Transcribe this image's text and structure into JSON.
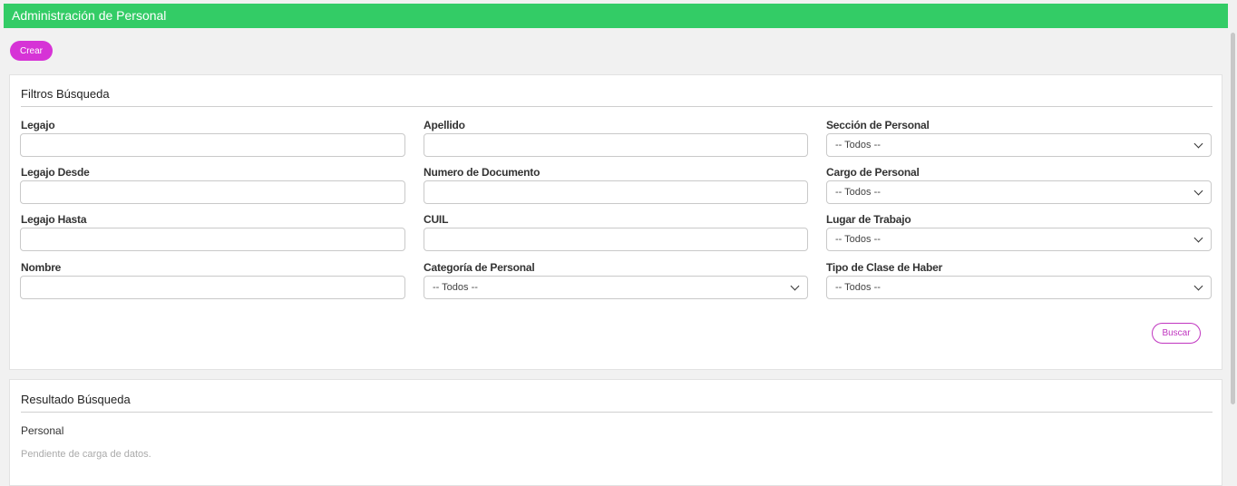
{
  "header": {
    "title": "Administración de Personal"
  },
  "actions": {
    "create_label": "Crear",
    "search_label": "Buscar"
  },
  "filters": {
    "title": "Filtros Búsqueda",
    "legajo": {
      "label": "Legajo",
      "value": ""
    },
    "legajo_desde": {
      "label": "Legajo Desde",
      "value": ""
    },
    "legajo_hasta": {
      "label": "Legajo Hasta",
      "value": ""
    },
    "nombre": {
      "label": "Nombre",
      "value": ""
    },
    "apellido": {
      "label": "Apellido",
      "value": ""
    },
    "numero_documento": {
      "label": "Numero de Documento",
      "value": ""
    },
    "cuil": {
      "label": "CUIL",
      "value": ""
    },
    "categoria_personal": {
      "label": "Categoría de Personal",
      "selected": "-- Todos --"
    },
    "seccion_personal": {
      "label": "Sección de Personal",
      "selected": "-- Todos --"
    },
    "cargo_personal": {
      "label": "Cargo de Personal",
      "selected": "-- Todos --"
    },
    "lugar_trabajo": {
      "label": "Lugar de Trabajo",
      "selected": "-- Todos --"
    },
    "tipo_clase_haber": {
      "label": "Tipo de Clase de Haber",
      "selected": "-- Todos --"
    }
  },
  "results": {
    "title": "Resultado Búsqueda",
    "subtitle": "Personal",
    "empty_message": "Pendiente de carga de datos."
  }
}
